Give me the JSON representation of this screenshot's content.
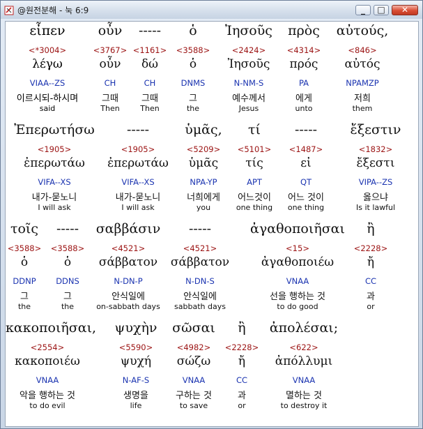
{
  "window": {
    "title": "@원전분해 - 눅 6:9",
    "min_label": "_",
    "max_label": "□",
    "close_label": "✕"
  },
  "icons": {
    "app": "book-icon"
  },
  "rows": [
    [
      {
        "greek": "εἶπεν",
        "strong": "<*3004>",
        "lexeme": "λέγω",
        "parsing": "VIAA--ZS",
        "korean": "이르시되-하시며",
        "english": "said"
      },
      {
        "greek": "οὖν",
        "strong": "<3767>",
        "lexeme": "οὖν",
        "parsing": "CH",
        "korean": "그때",
        "english": "Then"
      },
      {
        "greek": "-----",
        "strong": "<1161>",
        "lexeme": "δώ",
        "parsing": "CH",
        "korean": "그때",
        "english": "Then"
      },
      {
        "greek": "ὁ",
        "strong": "<3588>",
        "lexeme": "ὁ",
        "parsing": "DNMS",
        "korean": "그",
        "english": "the"
      },
      {
        "greek": "Ἰησοῦς",
        "strong": "<2424>",
        "lexeme": "Ἰησοῦς",
        "parsing": "N-NM-S",
        "korean": "예수께서",
        "english": "Jesus"
      },
      {
        "greek": "πρὸς",
        "strong": "<4314>",
        "lexeme": "πρός",
        "parsing": "PA",
        "korean": "에게",
        "english": "unto"
      },
      {
        "greek": "αὐτούς,",
        "strong": "<846>",
        "lexeme": "αὐτός",
        "parsing": "NPAMZP",
        "korean": "저희",
        "english": "them"
      }
    ],
    [
      {
        "greek": "Ἐπερωτήσω",
        "strong": "<1905>",
        "lexeme": "ἐπερωτάω",
        "parsing": "VIFA--XS",
        "korean": "내가-묻노니",
        "english": "I will ask"
      },
      {
        "greek": "-----",
        "strong": "<1905>",
        "lexeme": "ἐπερωτάω",
        "parsing": "VIFA--XS",
        "korean": "내가-묻노니",
        "english": "I will ask"
      },
      {
        "greek": "ὑμᾶς,",
        "strong": "<5209>",
        "lexeme": "ὑμᾶς",
        "parsing": "NPA-YP",
        "korean": "너희에게",
        "english": "you"
      },
      {
        "greek": "τί",
        "strong": "<5101>",
        "lexeme": "τίς",
        "parsing": "APT",
        "korean": "어느것이",
        "english": "one thing"
      },
      {
        "greek": "-----",
        "strong": "<1487>",
        "lexeme": "εἰ",
        "parsing": "QT",
        "korean": "어느 것이",
        "english": "one thing"
      },
      {
        "greek": "ἔξεστιν",
        "strong": "<1832>",
        "lexeme": "ἔξεστι",
        "parsing": "VIPA--ZS",
        "korean": "옳으냐",
        "english": "Is it lawful"
      }
    ],
    [
      {
        "greek": "τοῖς",
        "strong": "<3588>",
        "lexeme": "ὁ",
        "parsing": "DDNP",
        "korean": "그",
        "english": "the"
      },
      {
        "greek": "-----",
        "strong": "<3588>",
        "lexeme": "ὁ",
        "parsing": "DDNS",
        "korean": "그",
        "english": "the"
      },
      {
        "greek": "σαββάσιν",
        "strong": "<4521>",
        "lexeme": "σάββατον",
        "parsing": "N-DN-P",
        "korean": "안식일에",
        "english": "on-sabbath days"
      },
      {
        "greek": "-----",
        "strong": "<4521>",
        "lexeme": "σάββατον",
        "parsing": "N-DN-S",
        "korean": "안식일에",
        "english": "sabbath days"
      },
      {
        "greek": "ἀγαθοποιῆσαι",
        "strong": "<15>",
        "lexeme": "ἀγαθοποιέω",
        "parsing": "VNAA",
        "korean": "선을 행하는 것",
        "english": "to do good"
      },
      {
        "greek": "ἢ",
        "strong": "<2228>",
        "lexeme": "ἤ",
        "parsing": "CC",
        "korean": "과",
        "english": "or"
      }
    ],
    [
      {
        "greek": "κακοποιῆσαι,",
        "strong": "<2554>",
        "lexeme": "κακοποιέω",
        "parsing": "VNAA",
        "korean": "악을 행하는 것",
        "english": "to do evil"
      },
      {
        "greek": "ψυχὴν",
        "strong": "<5590>",
        "lexeme": "ψυχή",
        "parsing": "N-AF-S",
        "korean": "생명을",
        "english": "life"
      },
      {
        "greek": "σῶσαι",
        "strong": "<4982>",
        "lexeme": "σώζω",
        "parsing": "VNAA",
        "korean": "구하는 것",
        "english": "to save"
      },
      {
        "greek": "ἢ",
        "strong": "<2228>",
        "lexeme": "ἤ",
        "parsing": "CC",
        "korean": "과",
        "english": "or"
      },
      {
        "greek": "ἀπολέσαι;",
        "strong": "<622>",
        "lexeme": "ἀπόλλυμι",
        "parsing": "VNAA",
        "korean": "멸하는 것",
        "english": "to destroy it"
      }
    ]
  ],
  "colors": {
    "strong": "#9b1212",
    "parsing": "#1a33b0",
    "text": "#111111"
  }
}
